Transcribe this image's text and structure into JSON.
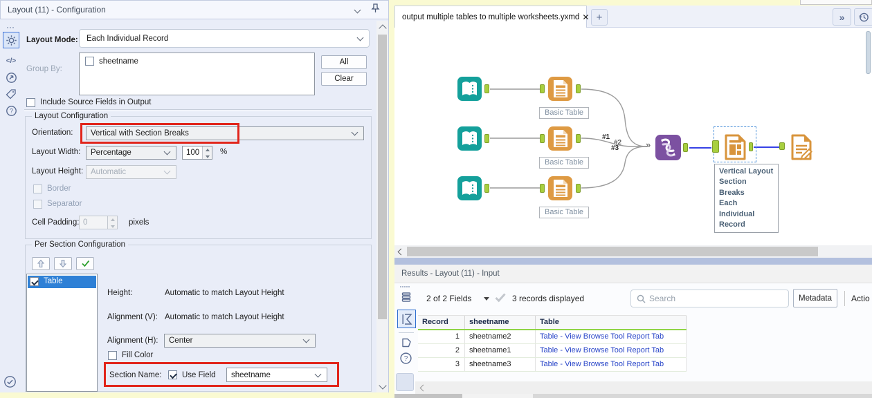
{
  "config": {
    "title": "Layout (11) - Configuration",
    "mode_label": "Layout Mode:",
    "mode_value": "Each Individual Record",
    "group_by_label": "Group By:",
    "group_by_item": "sheetname",
    "btn_all": "All",
    "btn_clear": "Clear",
    "include_label": "Include Source Fields in Output",
    "lc_title": "Layout Configuration",
    "orient_label": "Orientation:",
    "orient_value": "Vertical with Section Breaks",
    "width_label": "Layout Width:",
    "width_value": "Percentage",
    "width_amount": "100",
    "width_unit": "%",
    "height_label": "Layout Height:",
    "height_value": "Automatic",
    "border_label": "Border",
    "separator_label": "Separator",
    "pad_label": "Cell Padding:",
    "pad_value": "0",
    "pad_unit": "pixels",
    "ps_title": "Per Section Configuration",
    "ps_item": "Table",
    "ps_height_label": "Height:",
    "ps_height_value": "Automatic to match Layout Height",
    "ps_av_label": "Alignment (V):",
    "ps_av_value": "Automatic to match Layout Height",
    "ps_ah_label": "Alignment (H):",
    "ps_ah_value": "Center",
    "ps_fill_label": "Fill Color",
    "ps_name_label": "Section Name:",
    "ps_use_label": "Use Field",
    "ps_field_value": "sheetname"
  },
  "canvas": {
    "tab_title": "output multiple tables to multiple worksheets.yxmd",
    "basic_table_label": "Basic Table",
    "conn_labels": [
      "#1",
      "#2",
      "#3"
    ],
    "annotation_lines": [
      "Vertical Layout",
      "Section Breaks",
      "Each Individual",
      "Record"
    ]
  },
  "results": {
    "title": "Results - Layout (11) - Input",
    "fields_summary": "2 of 2 Fields",
    "records_summary": "3 records displayed",
    "search_placeholder": "Search",
    "metadata_label": "Metadata",
    "actions_label": "Actio",
    "columns": [
      "Record",
      "sheetname",
      "Table"
    ],
    "rows": [
      {
        "num": "1",
        "name": "sheetname2",
        "table": "Table - View Browse Tool Report Tab"
      },
      {
        "num": "2",
        "name": "sheetname1",
        "table": "Table - View Browse Tool Report Tab"
      },
      {
        "num": "3",
        "name": "sheetname3",
        "table": "Table - View Browse Tool Report Tab"
      }
    ]
  },
  "icons": {
    "close": "✕",
    "add_tab": "+",
    "overflow": "»",
    "multi_in": "»",
    "code": "</>"
  },
  "colors": {
    "accent_red": "#e1251b",
    "tool_teal": "#14A09B",
    "tool_orange": "#DE9A43",
    "tool_purple": "#7C51A1",
    "anchor_green": "#A8CF3F",
    "selection_blue": "#2e80d6",
    "connection_blue": "#3641e6",
    "link_blue": "#2845C8",
    "header_green": "#90D447",
    "panel_bg": "#e9edf8"
  }
}
